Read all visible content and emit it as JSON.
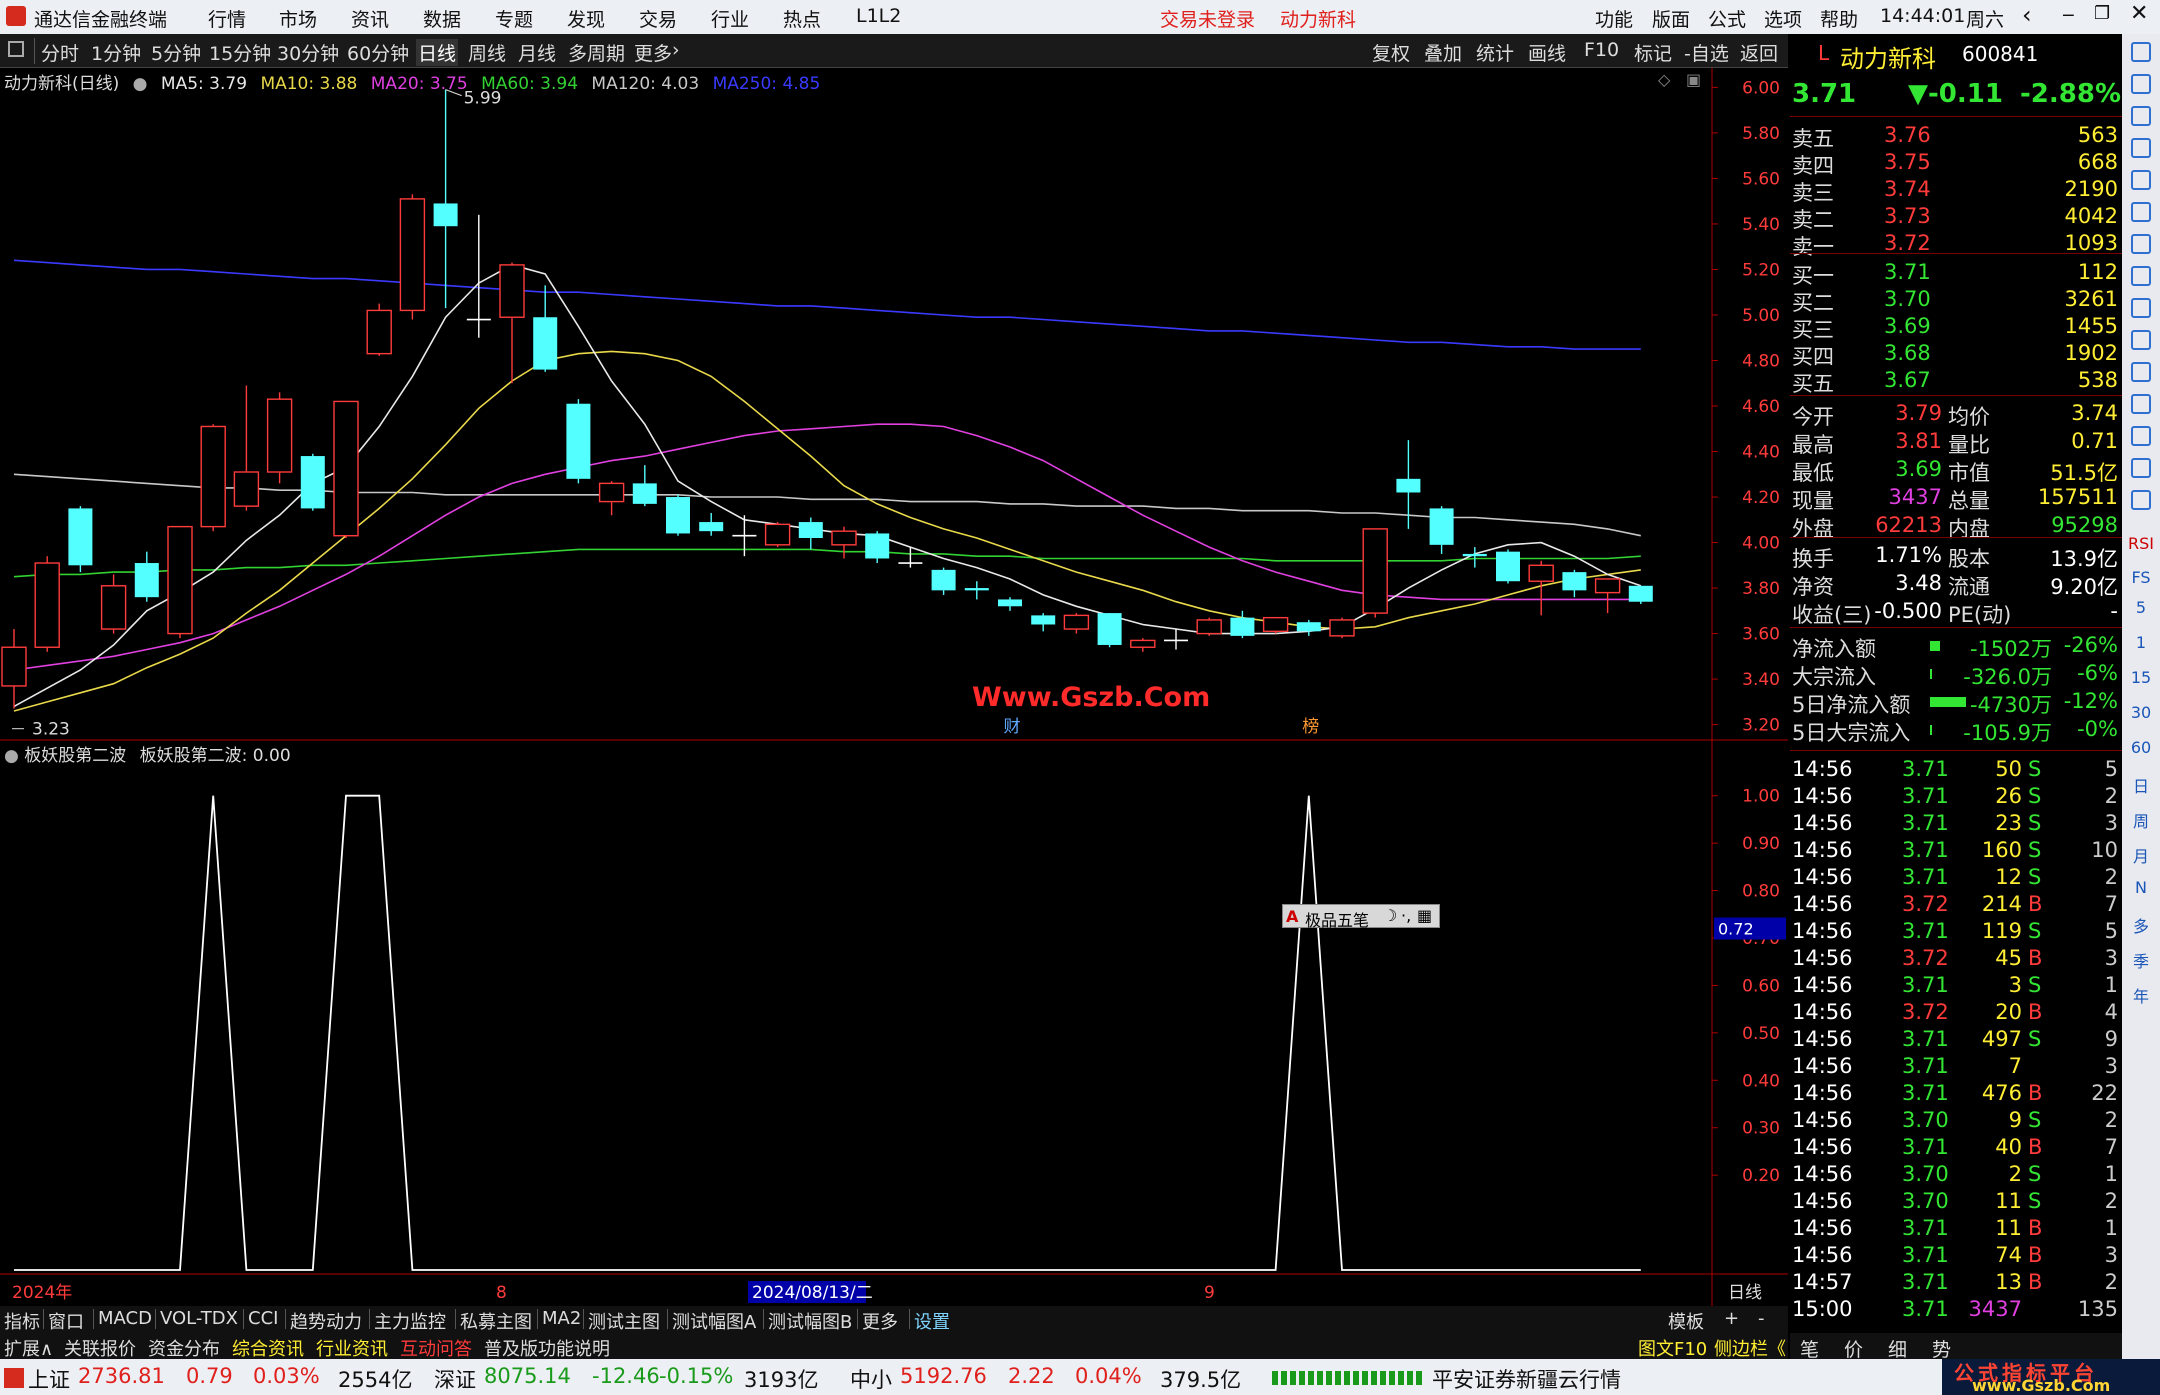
{
  "menubar": {
    "app_title": "通达信金融终端",
    "menu": [
      "行情",
      "市场",
      "资讯",
      "数据",
      "专题",
      "发现",
      "交易",
      "行业",
      "热点",
      "L1L2"
    ],
    "status_login": "交易未登录",
    "stock_name": "动力新科",
    "right_menu": [
      "功能",
      "版面",
      "公式",
      "选项",
      "帮助"
    ],
    "time": "14:44:01",
    "weekday": "周六"
  },
  "toolbar": {
    "periods": [
      "分时",
      "1分钟",
      "5分钟",
      "15分钟",
      "30分钟",
      "60分钟",
      "日线",
      "周线",
      "月线",
      "多周期",
      "更多"
    ],
    "active_period": "日线",
    "right_tools": [
      "复权",
      "叠加",
      "统计",
      "画线",
      "F10",
      "标记",
      "-自选",
      "返回"
    ]
  },
  "chart_header": {
    "title": "动力新科(日线)",
    "ma": [
      {
        "label": "MA5: 3.79",
        "color": "#e8e8e8"
      },
      {
        "label": "MA10: 3.88",
        "color": "#e8d84a"
      },
      {
        "label": "MA20: 3.75",
        "color": "#e040e0"
      },
      {
        "label": "MA60: 3.94",
        "color": "#32d232"
      },
      {
        "label": "MA120: 4.03",
        "color": "#c8c8c8"
      },
      {
        "label": "MA250: 4.85",
        "color": "#3a3aff"
      }
    ]
  },
  "chart_data": [
    {
      "type": "candlestick",
      "title": "动力新科(日线)",
      "y_ticks": [
        "6.00",
        "5.80",
        "5.60",
        "5.40",
        "5.20",
        "5.00",
        "4.80",
        "4.60",
        "4.40",
        "4.20",
        "4.00",
        "3.80",
        "3.60",
        "3.40",
        "3.20"
      ],
      "ylim": [
        3.15,
        6.05
      ],
      "high_marker": "5.99",
      "low_marker": "3.23",
      "candles": [
        {
          "o": 3.37,
          "c": 3.54,
          "h": 3.62,
          "l": 3.27
        },
        {
          "o": 3.54,
          "c": 3.91,
          "h": 3.94,
          "l": 3.52
        },
        {
          "o": 4.15,
          "c": 3.9,
          "h": 4.16,
          "l": 3.87
        },
        {
          "o": 3.62,
          "c": 3.81,
          "h": 3.86,
          "l": 3.6
        },
        {
          "o": 3.91,
          "c": 3.76,
          "h": 3.96,
          "l": 3.74
        },
        {
          "o": 3.6,
          "c": 4.07,
          "h": 4.07,
          "l": 3.58
        },
        {
          "o": 4.07,
          "c": 4.51,
          "h": 4.52,
          "l": 4.05
        },
        {
          "o": 4.16,
          "c": 4.31,
          "h": 4.69,
          "l": 4.14
        },
        {
          "o": 4.31,
          "c": 4.63,
          "h": 4.66,
          "l": 4.26
        },
        {
          "o": 4.38,
          "c": 4.15,
          "h": 4.39,
          "l": 4.14
        },
        {
          "o": 4.03,
          "c": 4.62,
          "h": 4.62,
          "l": 4.02
        },
        {
          "o": 4.83,
          "c": 5.02,
          "h": 5.05,
          "l": 4.82
        },
        {
          "o": 5.02,
          "c": 5.51,
          "h": 5.53,
          "l": 4.98
        },
        {
          "o": 5.49,
          "c": 5.39,
          "h": 5.99,
          "l": 5.03
        },
        {
          "o": 4.98,
          "c": 4.98,
          "h": 5.44,
          "l": 4.9
        },
        {
          "o": 4.99,
          "c": 5.22,
          "h": 5.23,
          "l": 4.7
        },
        {
          "o": 4.99,
          "c": 4.76,
          "h": 5.13,
          "l": 4.75
        },
        {
          "o": 4.61,
          "c": 4.28,
          "h": 4.63,
          "l": 4.26
        },
        {
          "o": 4.18,
          "c": 4.26,
          "h": 4.27,
          "l": 4.12
        },
        {
          "o": 4.26,
          "c": 4.17,
          "h": 4.34,
          "l": 4.16
        },
        {
          "o": 4.2,
          "c": 4.04,
          "h": 4.21,
          "l": 4.03
        },
        {
          "o": 4.09,
          "c": 4.05,
          "h": 4.13,
          "l": 4.03
        },
        {
          "o": 4.03,
          "c": 4.03,
          "h": 4.12,
          "l": 3.94
        },
        {
          "o": 3.99,
          "c": 4.08,
          "h": 4.09,
          "l": 3.98
        },
        {
          "o": 4.09,
          "c": 4.02,
          "h": 4.11,
          "l": 3.97
        },
        {
          "o": 3.99,
          "c": 4.05,
          "h": 4.07,
          "l": 3.93
        },
        {
          "o": 4.04,
          "c": 3.93,
          "h": 4.05,
          "l": 3.91
        },
        {
          "o": 3.91,
          "c": 3.91,
          "h": 3.98,
          "l": 3.89
        },
        {
          "o": 3.88,
          "c": 3.79,
          "h": 3.89,
          "l": 3.77
        },
        {
          "o": 3.8,
          "c": 3.79,
          "h": 3.83,
          "l": 3.75
        },
        {
          "o": 3.75,
          "c": 3.72,
          "h": 3.76,
          "l": 3.7
        },
        {
          "o": 3.68,
          "c": 3.64,
          "h": 3.69,
          "l": 3.61
        },
        {
          "o": 3.62,
          "c": 3.68,
          "h": 3.69,
          "l": 3.6
        },
        {
          "o": 3.69,
          "c": 3.55,
          "h": 3.69,
          "l": 3.54
        },
        {
          "o": 3.54,
          "c": 3.57,
          "h": 3.58,
          "l": 3.52
        },
        {
          "o": 3.57,
          "c": 3.57,
          "h": 3.62,
          "l": 3.53
        },
        {
          "o": 3.6,
          "c": 3.66,
          "h": 3.67,
          "l": 3.59
        },
        {
          "o": 3.67,
          "c": 3.59,
          "h": 3.7,
          "l": 3.58
        },
        {
          "o": 3.61,
          "c": 3.67,
          "h": 3.67,
          "l": 3.6
        },
        {
          "o": 3.65,
          "c": 3.61,
          "h": 3.66,
          "l": 3.59
        },
        {
          "o": 3.59,
          "c": 3.66,
          "h": 3.67,
          "l": 3.58
        },
        {
          "o": 3.69,
          "c": 4.06,
          "h": 4.06,
          "l": 3.67
        },
        {
          "o": 4.28,
          "c": 4.22,
          "h": 4.45,
          "l": 4.06
        },
        {
          "o": 4.15,
          "c": 3.99,
          "h": 4.16,
          "l": 3.95
        },
        {
          "o": 3.95,
          "c": 3.94,
          "h": 3.98,
          "l": 3.89
        },
        {
          "o": 3.96,
          "c": 3.83,
          "h": 3.97,
          "l": 3.82
        },
        {
          "o": 3.83,
          "c": 3.9,
          "h": 3.92,
          "l": 3.68
        },
        {
          "o": 3.87,
          "c": 3.79,
          "h": 3.88,
          "l": 3.76
        },
        {
          "o": 3.78,
          "c": 3.84,
          "h": 3.84,
          "l": 3.69
        },
        {
          "o": 3.81,
          "c": 3.74,
          "h": 3.81,
          "l": 3.73
        }
      ],
      "ma5": [
        3.28,
        3.36,
        3.44,
        3.55,
        3.7,
        3.78,
        3.87,
        4.01,
        4.12,
        4.26,
        4.33,
        4.51,
        4.73,
        4.99,
        5.14,
        5.22,
        5.18,
        4.95,
        4.71,
        4.52,
        4.27,
        4.18,
        4.1,
        4.08,
        4.06,
        4.04,
        4.03,
        3.98,
        3.93,
        3.89,
        3.84,
        3.77,
        3.72,
        3.68,
        3.64,
        3.62,
        3.6,
        3.6,
        3.6,
        3.61,
        3.63,
        3.71,
        3.8,
        3.88,
        3.95,
        3.99,
        4.0,
        3.94,
        3.86,
        3.81
      ],
      "ma10": [
        3.26,
        3.3,
        3.34,
        3.38,
        3.45,
        3.51,
        3.58,
        3.69,
        3.79,
        3.91,
        4.03,
        4.15,
        4.28,
        4.43,
        4.59,
        4.71,
        4.8,
        4.83,
        4.84,
        4.83,
        4.8,
        4.73,
        4.62,
        4.5,
        4.38,
        4.25,
        4.17,
        4.11,
        4.06,
        4.02,
        3.97,
        3.92,
        3.87,
        3.83,
        3.79,
        3.74,
        3.7,
        3.67,
        3.65,
        3.63,
        3.62,
        3.63,
        3.67,
        3.7,
        3.73,
        3.77,
        3.81,
        3.84,
        3.86,
        3.88
      ],
      "ma20": [
        3.44,
        3.46,
        3.48,
        3.5,
        3.53,
        3.56,
        3.6,
        3.66,
        3.72,
        3.79,
        3.86,
        3.94,
        4.03,
        4.12,
        4.2,
        4.26,
        4.3,
        4.33,
        4.36,
        4.38,
        4.41,
        4.44,
        4.47,
        4.49,
        4.5,
        4.51,
        4.52,
        4.52,
        4.51,
        4.47,
        4.42,
        4.36,
        4.28,
        4.2,
        4.12,
        4.05,
        3.98,
        3.92,
        3.87,
        3.83,
        3.79,
        3.77,
        3.76,
        3.75,
        3.75,
        3.75,
        3.75,
        3.75,
        3.75,
        3.75
      ],
      "ma60": [
        3.85,
        3.86,
        3.86,
        3.87,
        3.87,
        3.88,
        3.88,
        3.89,
        3.89,
        3.9,
        3.9,
        3.91,
        3.92,
        3.93,
        3.94,
        3.95,
        3.96,
        3.97,
        3.97,
        3.97,
        3.97,
        3.97,
        3.97,
        3.97,
        3.97,
        3.96,
        3.96,
        3.95,
        3.95,
        3.94,
        3.94,
        3.93,
        3.93,
        3.93,
        3.93,
        3.93,
        3.93,
        3.93,
        3.92,
        3.92,
        3.92,
        3.92,
        3.92,
        3.92,
        3.93,
        3.93,
        3.93,
        3.93,
        3.93,
        3.94
      ],
      "ma120": [
        4.3,
        4.29,
        4.28,
        4.27,
        4.26,
        4.25,
        4.24,
        4.24,
        4.23,
        4.23,
        4.22,
        4.22,
        4.22,
        4.21,
        4.21,
        4.21,
        4.21,
        4.21,
        4.21,
        4.21,
        4.21,
        4.2,
        4.2,
        4.2,
        4.19,
        4.19,
        4.19,
        4.18,
        4.18,
        4.18,
        4.17,
        4.17,
        4.16,
        4.16,
        4.16,
        4.15,
        4.15,
        4.14,
        4.14,
        4.14,
        4.13,
        4.13,
        4.12,
        4.11,
        4.11,
        4.1,
        4.09,
        4.08,
        4.06,
        4.03
      ],
      "ma250": [
        5.24,
        5.23,
        5.22,
        5.21,
        5.2,
        5.2,
        5.19,
        5.18,
        5.17,
        5.16,
        5.16,
        5.15,
        5.14,
        5.13,
        5.12,
        5.11,
        5.1,
        5.1,
        5.09,
        5.08,
        5.07,
        5.06,
        5.05,
        5.04,
        5.04,
        5.03,
        5.02,
        5.01,
        5.0,
        4.99,
        4.99,
        4.98,
        4.97,
        4.96,
        4.95,
        4.94,
        4.93,
        4.93,
        4.92,
        4.91,
        4.9,
        4.89,
        4.88,
        4.88,
        4.87,
        4.86,
        4.86,
        4.85,
        4.85,
        4.85
      ],
      "event_labels": [
        {
          "index": 30,
          "text": "财"
        },
        {
          "index": 39,
          "text": "榜"
        }
      ],
      "watermark": "Www.Gszb.Com"
    },
    {
      "type": "line",
      "title": "板妖股第二波",
      "series": [
        {
          "name": "板妖股第二波",
          "x_end_value": "0.00",
          "color": "#ffffff",
          "values": [
            0,
            0,
            0,
            0,
            0,
            0,
            1,
            0,
            0,
            0,
            1,
            1,
            0,
            0,
            0,
            0,
            0,
            0,
            0,
            0,
            0,
            0,
            0,
            0,
            0,
            0,
            0,
            0,
            0,
            0,
            0,
            0,
            0,
            0,
            0,
            0,
            0,
            0,
            0,
            1,
            0,
            0,
            0,
            0,
            0,
            0,
            0,
            0,
            0,
            0
          ]
        }
      ],
      "y_ticks": [
        "1.00",
        "0.90",
        "0.80",
        "0.70",
        "0.60",
        "0.50",
        "0.40",
        "0.30",
        "0.20"
      ],
      "ylim": [
        0,
        1.05
      ],
      "cursor_value": "0.72"
    }
  ],
  "x_axis": {
    "year_label": "2024年",
    "month8": "8",
    "date_cursor": "2024/08/13/二",
    "month9": "9",
    "period_label": "日线"
  },
  "popup": {
    "label": "极品五笔"
  },
  "quote": {
    "badge": "L",
    "name": "动力新科",
    "code": "600841",
    "price": "3.71",
    "change": "▼-0.11",
    "pct": "-2.88%",
    "asks": [
      {
        "label": "卖五",
        "price": "3.76",
        "vol": "563"
      },
      {
        "label": "卖四",
        "price": "3.75",
        "vol": "668"
      },
      {
        "label": "卖三",
        "price": "3.74",
        "vol": "2190"
      },
      {
        "label": "卖二",
        "price": "3.73",
        "vol": "4042"
      },
      {
        "label": "卖一",
        "price": "3.72",
        "vol": "1093"
      }
    ],
    "bids": [
      {
        "label": "买一",
        "price": "3.71",
        "vol": "112"
      },
      {
        "label": "买二",
        "price": "3.70",
        "vol": "3261"
      },
      {
        "label": "买三",
        "price": "3.69",
        "vol": "1455"
      },
      {
        "label": "买四",
        "price": "3.68",
        "vol": "1902"
      },
      {
        "label": "买五",
        "price": "3.67",
        "vol": "538"
      }
    ],
    "stats": [
      {
        "l1": "今开",
        "v1": "3.79",
        "l2": "均价",
        "v2": "3.74",
        "c1": "#ff3b3b",
        "c2": "#ffee33"
      },
      {
        "l1": "最高",
        "v1": "3.81",
        "l2": "量比",
        "v2": "0.71",
        "c1": "#ff3b3b",
        "c2": "#ffee33"
      },
      {
        "l1": "最低",
        "v1": "3.69",
        "l2": "市值",
        "v2": "51.5亿",
        "c1": "#33e633",
        "c2": "#ffee33"
      },
      {
        "l1": "现量",
        "v1": "3437",
        "l2": "总量",
        "v2": "157511",
        "c1": "#e040e0",
        "c2": "#ffee33"
      },
      {
        "l1": "外盘",
        "v1": "62213",
        "l2": "内盘",
        "v2": "95298",
        "c1": "#ff3b3b",
        "c2": "#33e633"
      }
    ],
    "fund": [
      {
        "l1": "换手",
        "v1": "1.71%",
        "l2": "股本",
        "v2": "13.9亿"
      },
      {
        "l1": "净资",
        "v1": "3.48",
        "l2": "流通",
        "v2": "9.20亿"
      },
      {
        "l1": "收益(三)",
        "v1": "-0.500",
        "l2": "PE(动)",
        "v2": "-"
      }
    ],
    "flows": [
      {
        "label": "净流入额",
        "value": "-1502万",
        "pct": "-26%"
      },
      {
        "label": "大宗流入",
        "value": "-326.0万",
        "pct": "-6%"
      },
      {
        "label": "5日净流入额",
        "value": "-4730万",
        "pct": "-12%"
      },
      {
        "label": "5日大宗流入",
        "value": "-105.9万",
        "pct": "-0%"
      }
    ],
    "ticks": [
      {
        "t": "14:56",
        "p": "3.71",
        "v": "50",
        "s": "S",
        "n": "5"
      },
      {
        "t": "14:56",
        "p": "3.71",
        "v": "26",
        "s": "S",
        "n": "2"
      },
      {
        "t": "14:56",
        "p": "3.71",
        "v": "23",
        "s": "S",
        "n": "3"
      },
      {
        "t": "14:56",
        "p": "3.71",
        "v": "160",
        "s": "S",
        "n": "10"
      },
      {
        "t": "14:56",
        "p": "3.71",
        "v": "12",
        "s": "S",
        "n": "2"
      },
      {
        "t": "14:56",
        "p": "3.72",
        "v": "214",
        "s": "B",
        "n": "7"
      },
      {
        "t": "14:56",
        "p": "3.71",
        "v": "119",
        "s": "S",
        "n": "5"
      },
      {
        "t": "14:56",
        "p": "3.72",
        "v": "45",
        "s": "B",
        "n": "3"
      },
      {
        "t": "14:56",
        "p": "3.71",
        "v": "3",
        "s": "S",
        "n": "1"
      },
      {
        "t": "14:56",
        "p": "3.72",
        "v": "20",
        "s": "B",
        "n": "4"
      },
      {
        "t": "14:56",
        "p": "3.71",
        "v": "497",
        "s": "S",
        "n": "9"
      },
      {
        "t": "14:56",
        "p": "3.71",
        "v": "7",
        "s": "",
        "n": "3"
      },
      {
        "t": "14:56",
        "p": "3.71",
        "v": "476",
        "s": "B",
        "n": "22"
      },
      {
        "t": "14:56",
        "p": "3.70",
        "v": "9",
        "s": "S",
        "n": "2"
      },
      {
        "t": "14:56",
        "p": "3.71",
        "v": "40",
        "s": "B",
        "n": "7"
      },
      {
        "t": "14:56",
        "p": "3.70",
        "v": "2",
        "s": "S",
        "n": "1"
      },
      {
        "t": "14:56",
        "p": "3.70",
        "v": "11",
        "s": "S",
        "n": "2"
      },
      {
        "t": "14:56",
        "p": "3.71",
        "v": "11",
        "s": "B",
        "n": "1"
      },
      {
        "t": "14:56",
        "p": "3.71",
        "v": "74",
        "s": "B",
        "n": "3"
      },
      {
        "t": "14:57",
        "p": "3.71",
        "v": "13",
        "s": "B",
        "n": "2"
      },
      {
        "t": "15:00",
        "p": "3.71",
        "v": "3437",
        "s": "",
        "n": "135"
      }
    ]
  },
  "right_side_labels": [
    "RSI",
    "FS",
    "5",
    "1",
    "15",
    "30",
    "60",
    "日",
    "周",
    "月",
    "N",
    "多",
    "季",
    "年"
  ],
  "bottom_tabs1": [
    "指标",
    "窗口",
    "MACD",
    "VOL-TDX",
    "CCI",
    "趋势动力",
    "主力监控",
    "私募主图",
    "MA2",
    "测试主图",
    "测试幅图A",
    "测试幅图B",
    "更多",
    "设置"
  ],
  "bottom_tabs1_right": [
    "模板",
    "+",
    "-"
  ],
  "bottom_tabs2": [
    "扩展∧",
    "关联报价",
    "资金分布",
    "综合资讯",
    "行业资讯",
    "互动问答",
    "普及版功能说明"
  ],
  "bottom_tabs2_right": [
    "图文F10",
    "侧边栏《"
  ],
  "quote_tabs": [
    "笔",
    "价",
    "细",
    "势"
  ],
  "status": {
    "indices": [
      {
        "name": "上证",
        "value": "2736.81",
        "chg": "0.79",
        "pct": "0.03%",
        "amt": "2554亿"
      },
      {
        "name": "深证",
        "value": "8075.14",
        "chg": "-12.46",
        "pct": "-0.15%",
        "amt": "3193亿"
      },
      {
        "name": "中小",
        "value": "5192.76",
        "chg": "2.22",
        "pct": "0.04%",
        "amt": "379.5亿"
      }
    ],
    "broker": "平安证券新疆云行情",
    "brand": "公式指标平台",
    "brand_url": "www.Gszb.Com"
  }
}
